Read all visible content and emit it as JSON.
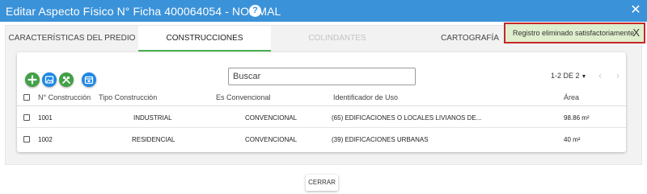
{
  "window": {
    "title": "Editar Aspecto Físico N° Ficha 400064054 - NORMAL",
    "help_icon": "?",
    "close_icon": "✕"
  },
  "tabs": [
    {
      "label": "CARACTERÍSTICAS DEL PREDIO",
      "state": "normal"
    },
    {
      "label": "CONSTRUCCIONES",
      "state": "active"
    },
    {
      "label": "COLINDANTES",
      "state": "disabled"
    },
    {
      "label": "CARTOGRAFÍA",
      "state": "normal"
    }
  ],
  "toolbar": {
    "buttons": [
      {
        "name": "add-icon",
        "color": "#43a047"
      },
      {
        "name": "image-icon",
        "color": "#1e88e5"
      },
      {
        "name": "tools-icon",
        "color": "#43a047"
      },
      {
        "name": "calendar-icon",
        "color": "#1e88e5"
      }
    ],
    "search_placeholder": "Buscar",
    "pager_text": "1-2 DE 2",
    "pager_caret": "▼",
    "prev": "‹",
    "next": "›"
  },
  "table": {
    "columns": [
      "N° Construcción",
      "Tipo Construcción",
      "Es Convencional",
      "Identificador de Uso",
      "Área"
    ],
    "rows": [
      [
        "1001",
        "INDUSTRIAL",
        "CONVENCIONAL",
        "(65) EDIFICACIONES O LOCALES LIVIANOS DE...",
        "98.86 m²"
      ],
      [
        "1002",
        "RESIDENCIAL",
        "CONVENCIONAL",
        "(39) EDIFICACIONES URBANAS",
        "40 m²"
      ]
    ]
  },
  "footer": {
    "close_label": "CERRAR"
  },
  "toast": {
    "message": "Registro eliminado satisfactoriamente",
    "close": "X"
  },
  "colors": {
    "header": "#3a92d9",
    "active_tab_underline": "#4caf50",
    "toast_bg": "#dfeecd",
    "toast_border": "#c62828"
  }
}
